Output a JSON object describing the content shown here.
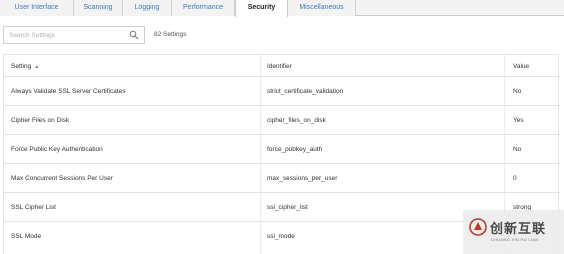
{
  "tabs": [
    {
      "label": "User Interface"
    },
    {
      "label": "Scanning"
    },
    {
      "label": "Logging"
    },
    {
      "label": "Performance"
    },
    {
      "label": "Security"
    },
    {
      "label": "Miscellaneous"
    }
  ],
  "active_tab": "Security",
  "search": {
    "placeholder": "Search Settings",
    "value": ""
  },
  "settings_count": "82 Settings",
  "table": {
    "headers": {
      "setting": "Setting",
      "identifier": "Identifier",
      "value": "Value"
    },
    "sort_indicator": "▲",
    "rows": [
      {
        "setting": "Always Validate SSL Server Certificates",
        "identifier": "strict_certificate_validation",
        "value": "No"
      },
      {
        "setting": "Cipher Files on Disk",
        "identifier": "cipher_files_on_disk",
        "value": "Yes"
      },
      {
        "setting": "Force Public Key Authentication",
        "identifier": "force_pubkey_auth",
        "value": "No"
      },
      {
        "setting": "Max Concurrent Sessions Per User",
        "identifier": "max_sessions_per_user",
        "value": "0"
      },
      {
        "setting": "SSL Cipher List",
        "identifier": "ssl_cipher_list",
        "value": "strong"
      },
      {
        "setting": "SSL Mode",
        "identifier": "ssl_mode",
        "value": ""
      }
    ]
  },
  "watermark": {
    "text_cn": "创新互联",
    "text_en": "CHUANG XIN HU LIAN"
  },
  "colors": {
    "tab_link": "#3a7bc8",
    "border": "#e3e3e3"
  }
}
